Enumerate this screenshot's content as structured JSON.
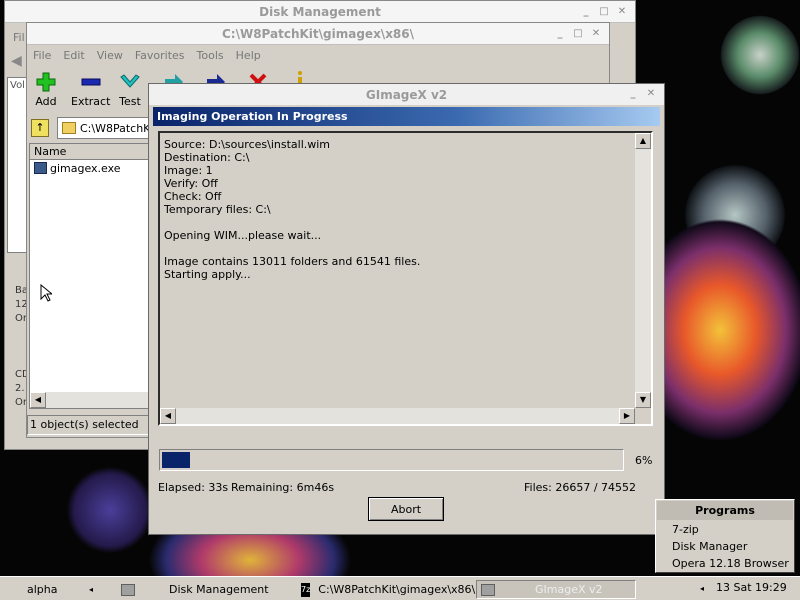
{
  "disk_window": {
    "title": "Disk Management",
    "menu_first": "Fil",
    "labels": [
      "Vol",
      "Ba",
      "12",
      "On",
      "CD",
      "2.",
      "On"
    ]
  },
  "explorer": {
    "title": "C:\\W8PatchKit\\gimagex\\x86\\",
    "menu": [
      "File",
      "Edit",
      "View",
      "Favorites",
      "Tools",
      "Help"
    ],
    "tools": [
      {
        "label": "Add",
        "icon": "add-icon"
      },
      {
        "label": "Extract",
        "icon": "extract-icon"
      },
      {
        "label": "Test",
        "icon": "test-icon"
      }
    ],
    "address": "C:\\W8PatchKi",
    "column_name": "Name",
    "file": "gimagex.exe",
    "status": "1 object(s) selected"
  },
  "dialog": {
    "title": "GImageX v2",
    "caption": "Imaging Operation In Progress",
    "log_lines": [
      "Source: D:\\sources\\install.wim",
      "Destination: C:\\",
      "Image: 1",
      "Verify: Off",
      "Check: Off",
      "Temporary files: C:\\",
      "",
      "Opening WIM...please wait...",
      "",
      "Image contains 13011 folders and 61541 files.",
      "Starting apply..."
    ],
    "progress_percent": 6,
    "progress_label": "6%",
    "elapsed": "Elapsed: 33s",
    "remaining": "Remaining: 6m46s",
    "files": "Files: 26657 / 74552",
    "abort_label": "Abort"
  },
  "programs_menu": {
    "header": "Programs",
    "items": [
      "7-zip",
      "Disk Manager",
      "Opera 12.18 Browser"
    ]
  },
  "taskbar": {
    "start": "alpha",
    "tasks": [
      "Disk Management",
      "C:\\W8PatchKit\\gimagex\\x86\\",
      "GImageX v2"
    ],
    "clock": "13 Sat 19:29"
  }
}
